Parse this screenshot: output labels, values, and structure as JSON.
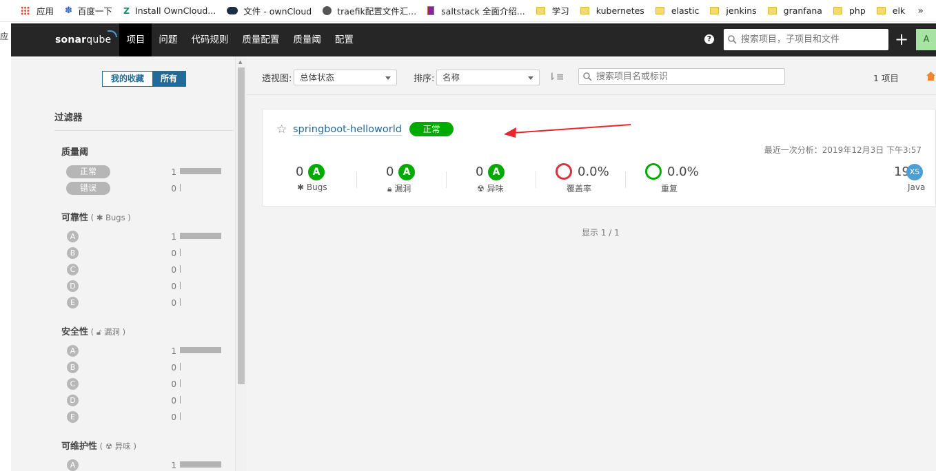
{
  "bookmarks": [
    {
      "label": "应用",
      "icon": "apps-grid-icon"
    },
    {
      "label": "百度一下",
      "icon": "baidu-paw-icon"
    },
    {
      "label": "Install OwnCloud...",
      "icon": "owncloud-icon"
    },
    {
      "label": "文件 - ownCloud",
      "icon": "cloud-icon"
    },
    {
      "label": "traefik配置文件汇...",
      "icon": "globe-icon"
    },
    {
      "label": "saltstack 全面介绍...",
      "icon": "book-icon"
    },
    {
      "label": "学习",
      "icon": "folder-icon"
    },
    {
      "label": "kubernetes",
      "icon": "folder-icon"
    },
    {
      "label": "elastic",
      "icon": "folder-icon"
    },
    {
      "label": "jenkins",
      "icon": "folder-icon"
    },
    {
      "label": "granfana",
      "icon": "folder-icon"
    },
    {
      "label": "php",
      "icon": "folder-icon"
    },
    {
      "label": "elk",
      "icon": "folder-icon"
    }
  ],
  "bookmarks_more": "»",
  "side_stub": "应",
  "navbar": {
    "logo_bold": "sonar",
    "logo_light": "qube",
    "items": [
      "项目",
      "问题",
      "代码规则",
      "质量配置",
      "质量阈",
      "配置"
    ],
    "active": "项目",
    "help": "?",
    "search_placeholder": "搜索项目，子项目和文件",
    "plus": "+",
    "avatar": "A"
  },
  "sidebar": {
    "toggle": {
      "favorites": "我的收藏",
      "all": "所有"
    },
    "filters_title": "过滤器",
    "quality_gate": {
      "title": "质量阈",
      "options": [
        {
          "label": "正常",
          "count": "1",
          "fraction": 1.0
        },
        {
          "label": "错误",
          "count": "0",
          "fraction": 0.0
        }
      ]
    },
    "reliability": {
      "title": "可靠性",
      "sub": "Bugs",
      "grades": [
        {
          "label": "A",
          "count": "1",
          "fraction": 1.0
        },
        {
          "label": "B",
          "count": "0",
          "fraction": 0.0
        },
        {
          "label": "C",
          "count": "0",
          "fraction": 0.0
        },
        {
          "label": "D",
          "count": "0",
          "fraction": 0.0
        },
        {
          "label": "E",
          "count": "0",
          "fraction": 0.0
        }
      ]
    },
    "security": {
      "title": "安全性",
      "sub": "漏洞",
      "grades": [
        {
          "label": "A",
          "count": "1",
          "fraction": 1.0
        },
        {
          "label": "B",
          "count": "0",
          "fraction": 0.0
        },
        {
          "label": "C",
          "count": "0",
          "fraction": 0.0
        },
        {
          "label": "D",
          "count": "0",
          "fraction": 0.0
        },
        {
          "label": "E",
          "count": "0",
          "fraction": 0.0
        }
      ]
    },
    "maintainability": {
      "title": "可维护性",
      "sub": "异味",
      "grades": [
        {
          "label": "A",
          "count": "1",
          "fraction": 1.0
        }
      ]
    }
  },
  "toolbar": {
    "perspective_label": "透视图:",
    "perspective_value": "总体状态",
    "sort_label": "排序:",
    "sort_value": "名称",
    "search_placeholder": "搜索项目名或标识",
    "project_count": "1 项目"
  },
  "project": {
    "name": "springboot-helloworld",
    "quality_gate": "正常",
    "last_analysis": "最近一次分析：2019年12月3日 下午3:57",
    "metrics": {
      "bugs": {
        "value": "0",
        "grade": "A",
        "label": "Bugs"
      },
      "vulnerabilities": {
        "value": "0",
        "grade": "A",
        "label": "漏洞"
      },
      "code_smells": {
        "value": "0",
        "grade": "A",
        "label": "异味"
      },
      "coverage": {
        "value": "0.0%",
        "label": "覆盖率"
      },
      "duplications": {
        "value": "0.0%",
        "label": "重复"
      },
      "size": {
        "value": "19",
        "badge": "XS",
        "label": "Java"
      }
    }
  },
  "paging": "显示 1 / 1",
  "colors": {
    "nav_bg": "#262626",
    "link": "#236a97",
    "ok_green": "#00aa00",
    "coverage_red": "#d4333f",
    "size_blue": "#4b9fd5"
  }
}
